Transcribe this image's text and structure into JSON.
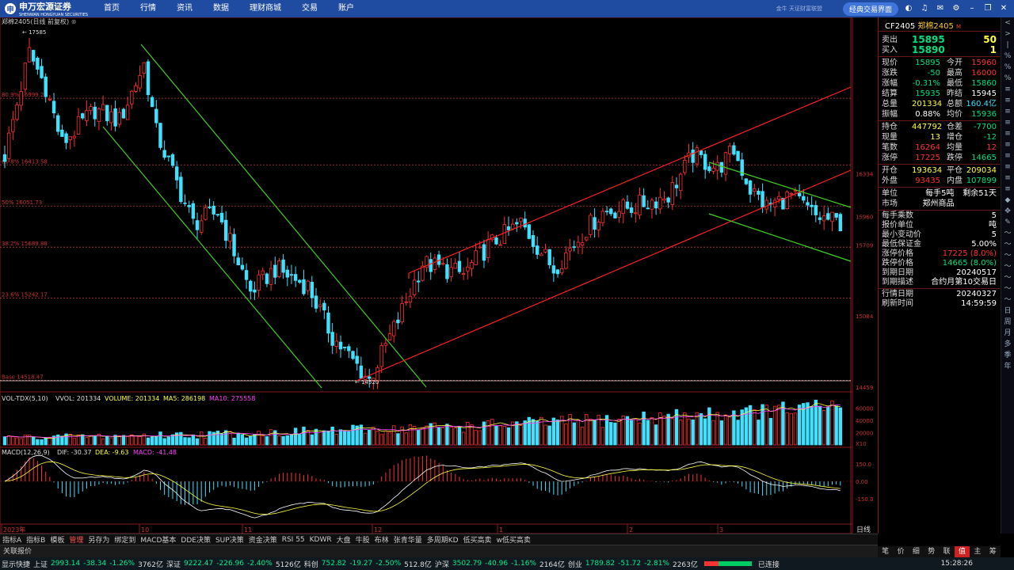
{
  "topbar": {
    "logo_cn": "申万宏源证券",
    "logo_en": "SHENWAN HONGYUAN SECURITIES",
    "nav": [
      "首页",
      "行情",
      "资讯",
      "数据",
      "理财商城",
      "交易",
      "账户"
    ],
    "hint": "金牛 天证财富联盟",
    "classic": "经典交易界面"
  },
  "chart": {
    "symbol": "郑棉2405",
    "period": "(日线 前复权)",
    "high_mark": "17585",
    "low_mark": "14520",
    "fib": [
      {
        "label": "80.9% 16999.29"
      },
      {
        "label": "61.8% 16413.58"
      },
      {
        "label": "50% 16051.73"
      },
      {
        "label": "38.2% 15689.88"
      },
      {
        "label": "23.6% 15242.17"
      },
      {
        "label": "Base 14518.47"
      }
    ],
    "price_axis": [
      "15960",
      "16334",
      "15709",
      "15084",
      "14459"
    ],
    "vol_legend": {
      "name": "VOL-TDX(5,10)",
      "vvol": "VVOL: 201334",
      "volume": "VOLUME: 201334",
      "ma5": "MA5: 286198",
      "ma10": "MA10: 275558"
    },
    "vol_axis": [
      "60000",
      "40000",
      "20000",
      "X10"
    ],
    "macd_legend": {
      "name": "MACD(12,26,9)",
      "dif": "DIF: -30.37",
      "dea": "DEA: -9.63",
      "macd": "MACD: -41.48"
    },
    "macd_axis": [
      "150.0",
      "0.00",
      "-150.0"
    ],
    "date_labels": [
      "2023年",
      "10",
      "11",
      "12",
      "1",
      "2",
      "3"
    ],
    "period_btn": "日线"
  },
  "colors": {
    "up": "#ff3030",
    "down": "#40e0ff",
    "ma5": "#ffff40",
    "ma10": "#ff40ff",
    "channel_green": "#40d020",
    "channel_red": "#ff2020",
    "fib_line": "#c04040"
  },
  "panel": {
    "title_code": "CF2405",
    "title_name": "郑棉2405",
    "title_tag": "M",
    "sell": {
      "label": "卖出",
      "price": "15895",
      "vol": "50"
    },
    "buy": {
      "label": "买入",
      "price": "15890",
      "vol": "1"
    },
    "rows1": [
      [
        "现价",
        "15895",
        "今开",
        "15960"
      ],
      [
        "涨跌",
        "-50",
        "最高",
        "16000"
      ],
      [
        "涨幅",
        "-0.31%",
        "最低",
        "15860"
      ],
      [
        "结算",
        "15935",
        "昨结",
        "15945"
      ],
      [
        "总量",
        "201334",
        "总额",
        "160.4亿"
      ],
      [
        "振幅",
        "0.88%",
        "均价",
        "15936"
      ]
    ],
    "rows2": [
      [
        "持仓",
        "447792",
        "仓差",
        "-7700"
      ],
      [
        "现量",
        "13",
        "增仓",
        "-12"
      ],
      [
        "笔数",
        "16264",
        "均量",
        "12"
      ],
      [
        "涨停",
        "17225",
        "跌停",
        "14665"
      ]
    ],
    "rows3": [
      [
        "开仓",
        "193634",
        "平仓",
        "209034"
      ],
      [
        "外盘",
        "93435",
        "内盘",
        "107899"
      ]
    ],
    "rows4": [
      [
        "单位",
        "每手5吨",
        "剩余51天"
      ],
      [
        "市场",
        "郑州商品",
        ""
      ]
    ],
    "kv": [
      [
        "每手乘数",
        "5"
      ],
      [
        "报价单位",
        "吨"
      ],
      [
        "最小变动价",
        "5"
      ],
      [
        "最低保证金",
        "5.00%"
      ],
      [
        "涨停价格",
        "17225 (8.0%)"
      ],
      [
        "跌停价格",
        "14665 (8.0%)"
      ],
      [
        "到期日期",
        "20240517"
      ],
      [
        "到期描述",
        "合约月第10交易日"
      ],
      [
        "行情日期",
        "20240327"
      ],
      [
        "刷新时间",
        "14:59:59"
      ]
    ]
  },
  "side_icons": [
    "<",
    ">",
    "|",
    "%",
    "%",
    "%",
    "≡",
    "≡",
    "≡",
    "≡",
    "≡",
    "≡",
    "≡",
    "≡",
    "≡",
    "≡",
    "◆",
    "✥",
    "✎",
    "〜",
    "〜",
    "〜",
    "〜",
    "〜",
    "〜",
    "〜",
    "日",
    "周",
    "月",
    "多",
    "季",
    "年"
  ],
  "ptabs": [
    "笔",
    "价",
    "细",
    "势",
    "联",
    "值",
    "主",
    "筹"
  ],
  "btabs": [
    "指标A",
    "指标B",
    "模板",
    "管理",
    "另存为",
    "绑定到",
    "MACD基本",
    "DDE决策",
    "SUP决策",
    "资金决策",
    "RSI 55",
    "KDWR",
    "大盘",
    "牛股",
    "布林",
    "张青华量",
    "多周期KD",
    "低买高卖",
    "w低买高卖"
  ],
  "quote_bar": "关联报价",
  "status": {
    "show": "显示快捷",
    "sh": "上证",
    "sh_v": "2993.14",
    "sh_c": "-38.34",
    "sh_p": "-1.26%",
    "sh_a": "3762亿",
    "sz": "深证",
    "sz_v": "9222.47",
    "sz_c": "-226.96",
    "sz_p": "-2.40%",
    "sz_a": "5126亿",
    "kc": "科创",
    "kc_v": "752.82",
    "kc_c": "-19.27",
    "kc_p": "-2.50%",
    "kc_a": "512.8亿",
    "hs": "沪深",
    "hs_v": "3502.79",
    "hs_c": "-40.96",
    "hs_p": "-1.16%",
    "hs_a": "2164亿",
    "cy": "创业",
    "cy_v": "1789.82",
    "cy_c": "-51.72",
    "cy_p": "-2.81%",
    "cy_a": "2263亿",
    "conn": "已连接",
    "time": "15:28:26"
  }
}
